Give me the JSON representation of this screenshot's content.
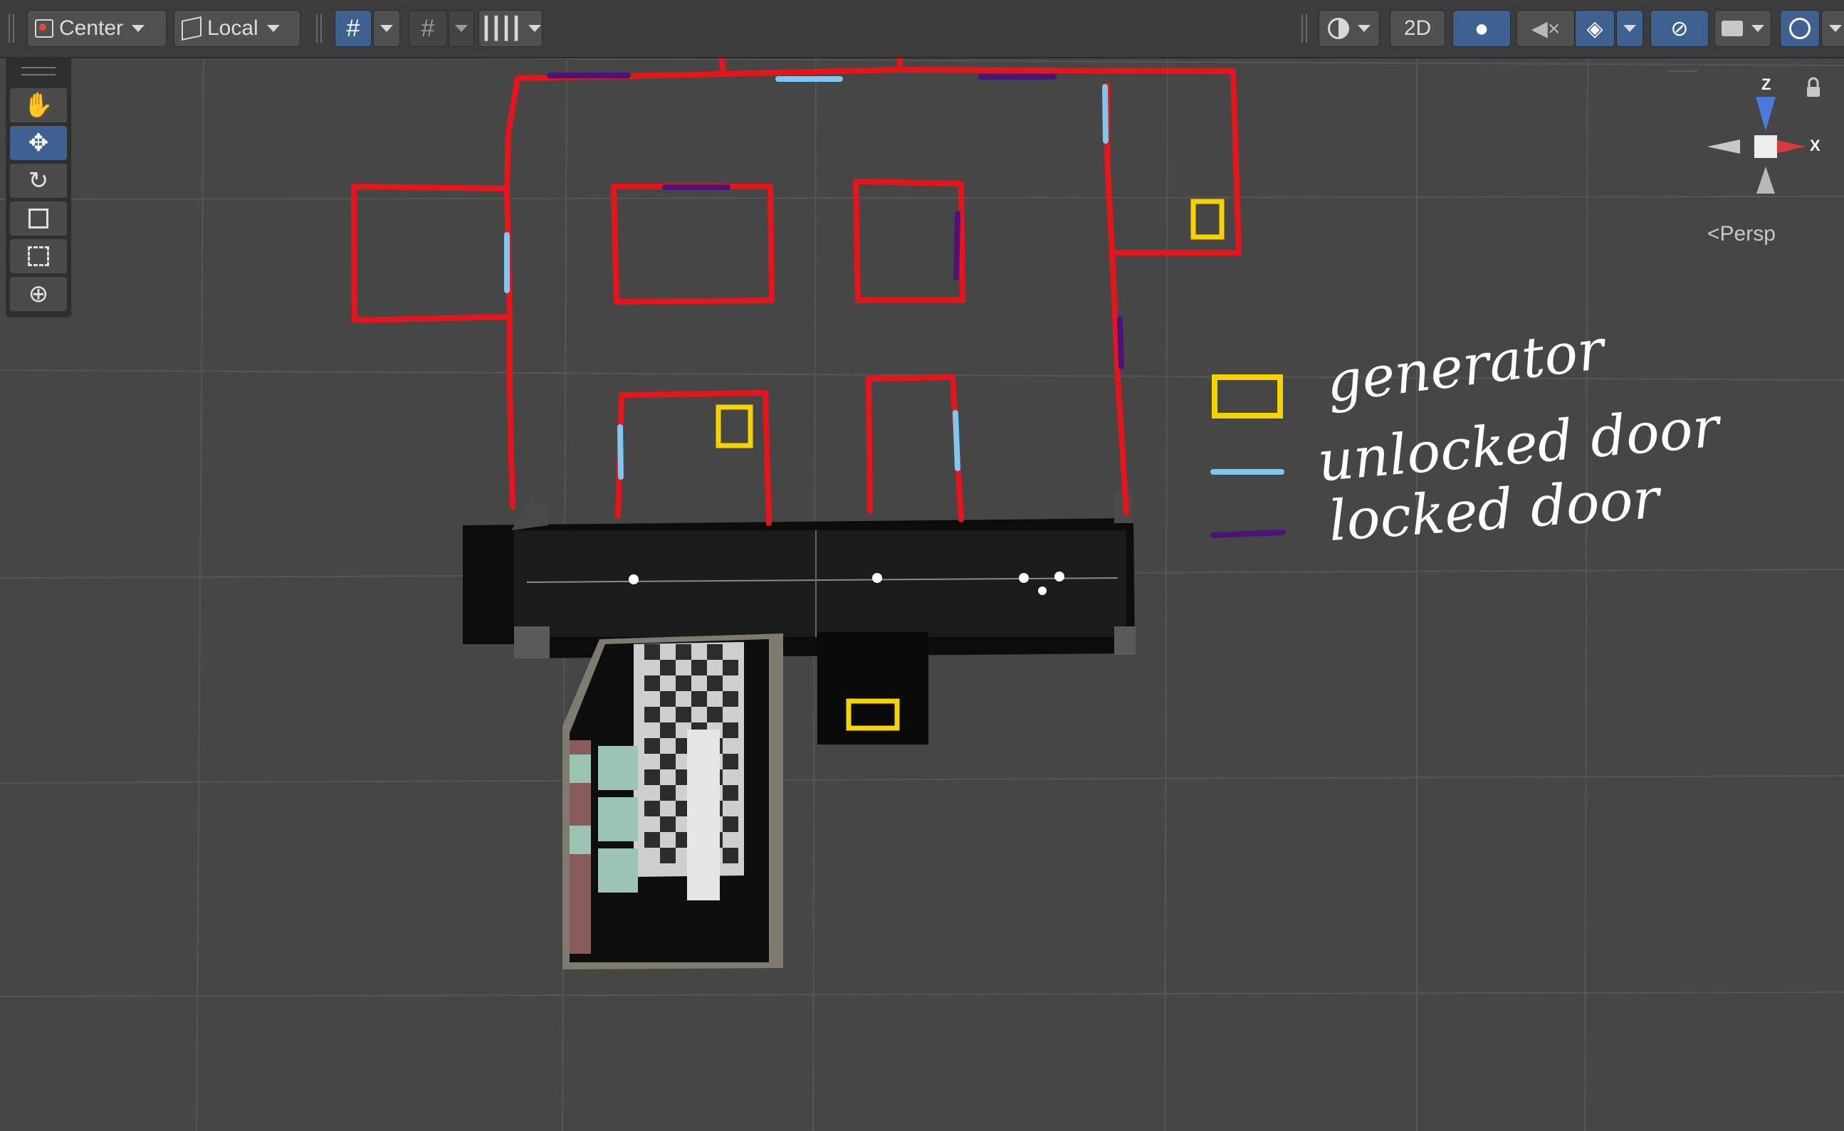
{
  "toolbar": {
    "pivot_mode": "Center",
    "pivot_rotation": "Local",
    "mode_2d": "2D"
  },
  "scene_view": {
    "projection_label": "Persp",
    "gizmo_axes": {
      "z": "Z",
      "x": "X"
    }
  },
  "tools": [
    "hand-tool",
    "move-tool",
    "rotate-tool",
    "scale-tool",
    "rect-tool",
    "transform-tool"
  ],
  "legend": {
    "generator": "generator",
    "unlocked_door": "unlocked door",
    "locked_door": "locked door"
  },
  "colors": {
    "walls": "#e8141c",
    "unlocked_door": "#7fc6f0",
    "locked_door": "#4a1478",
    "generator": "#f5d300",
    "background": "#464646",
    "toolbar": "#3c3c3c",
    "active_tool": "#3f6191"
  },
  "icons": {
    "toolbar": [
      "pivot-icon",
      "local-cube-icon",
      "grid-snap-icon",
      "increment-snap-icon",
      "ruler-icon",
      "shading-icon",
      "light-icon",
      "audio-mute-icon",
      "effects-icon",
      "hidden-icon",
      "camera-icon",
      "gizmos-icon"
    ],
    "overlay": [
      "lock-icon",
      "orientation-gizmo"
    ]
  }
}
